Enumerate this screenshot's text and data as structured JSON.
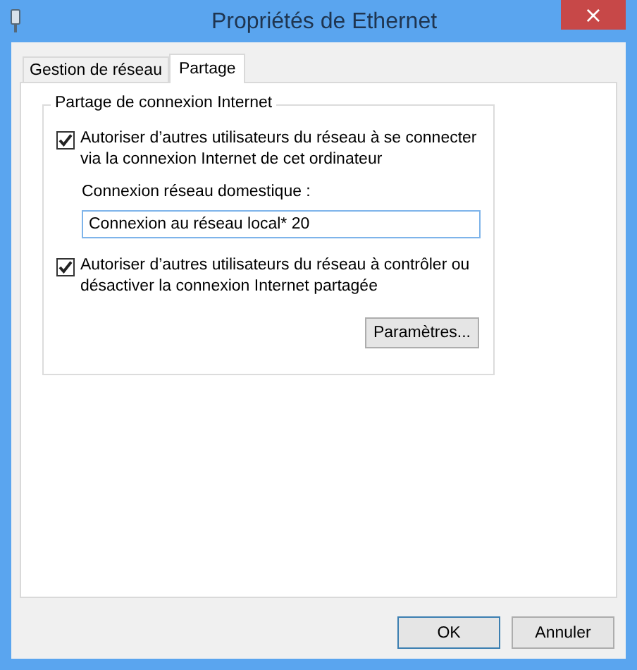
{
  "window": {
    "title": "Propriétés de Ethernet",
    "close": "×"
  },
  "tabs": [
    {
      "label": "Gestion de réseau",
      "selected": false
    },
    {
      "label": "Partage",
      "selected": true
    }
  ],
  "group": {
    "title": "Partage de connexion Internet",
    "options": [
      {
        "kind": "checkbox",
        "label": "Autoriser d’autres utilisateurs du réseau à se connecter via la connexion Internet de cet ordinateur",
        "checked": true
      },
      {
        "kind": "field",
        "label": "Connexion réseau domestique :",
        "value": "Connexion au réseau local* 20"
      },
      {
        "kind": "checkbox",
        "label": "Autoriser d’autres utilisateurs du réseau à contrôler ou désactiver la connexion Internet partagée",
        "checked": true
      },
      {
        "kind": "button",
        "label": "Paramètres..."
      }
    ]
  },
  "buttons": [
    {
      "label": "OK",
      "default": true
    },
    {
      "label": "Annuler",
      "default": false
    }
  ]
}
